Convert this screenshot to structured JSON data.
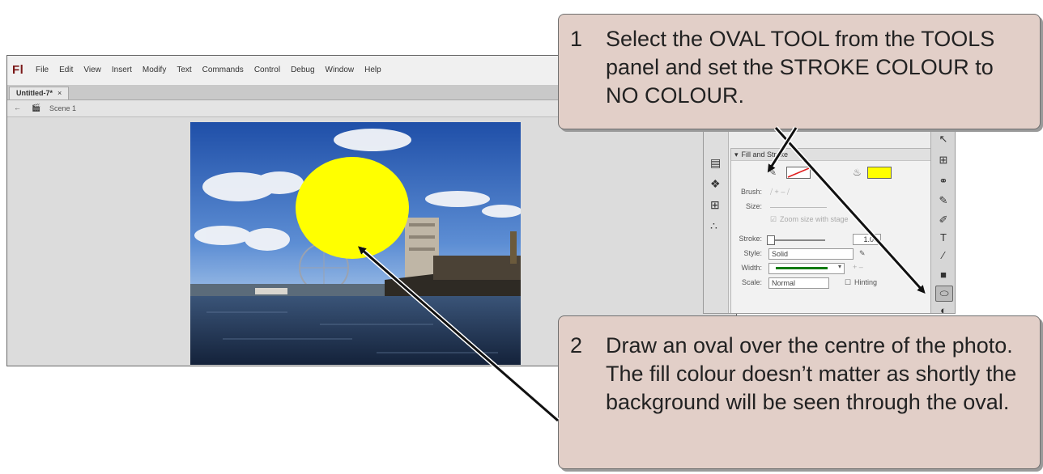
{
  "app": {
    "logo": "Fl",
    "menu": [
      "File",
      "Edit",
      "View",
      "Insert",
      "Modify",
      "Text",
      "Commands",
      "Control",
      "Debug",
      "Window",
      "Help"
    ],
    "doc_tab": "Untitled-7*",
    "doc_tab_close": "×",
    "scene": "Scene 1"
  },
  "properties": {
    "section": "Fill and Stroke",
    "brush_label": "Brush:",
    "size_label": "Size:",
    "zoom_checkbox": "Zoom size with stage",
    "stroke_label": "Stroke:",
    "stroke_value": "1.00",
    "style_label": "Style:",
    "style_value": "Solid",
    "width_label": "Width:",
    "scale_label": "Scale:",
    "scale_value": "Normal",
    "hinting_label": "Hinting",
    "fill_color": "#ffff00",
    "stroke_line_color": "#117a11"
  },
  "colors": {
    "callout_bg": "#e2cfc8",
    "oval_fill": "#ffff00"
  },
  "callouts": {
    "step1_num": "1",
    "step1_text": "Select the OVAL TOOL from the TOOLS panel and set the STROKE COLOUR to NO COLOUR.",
    "step2_num": "2",
    "step2_text": "Draw an oval over the centre of the photo. The fill colour doesn’t matter as shortly the background will be seen through the oval."
  }
}
